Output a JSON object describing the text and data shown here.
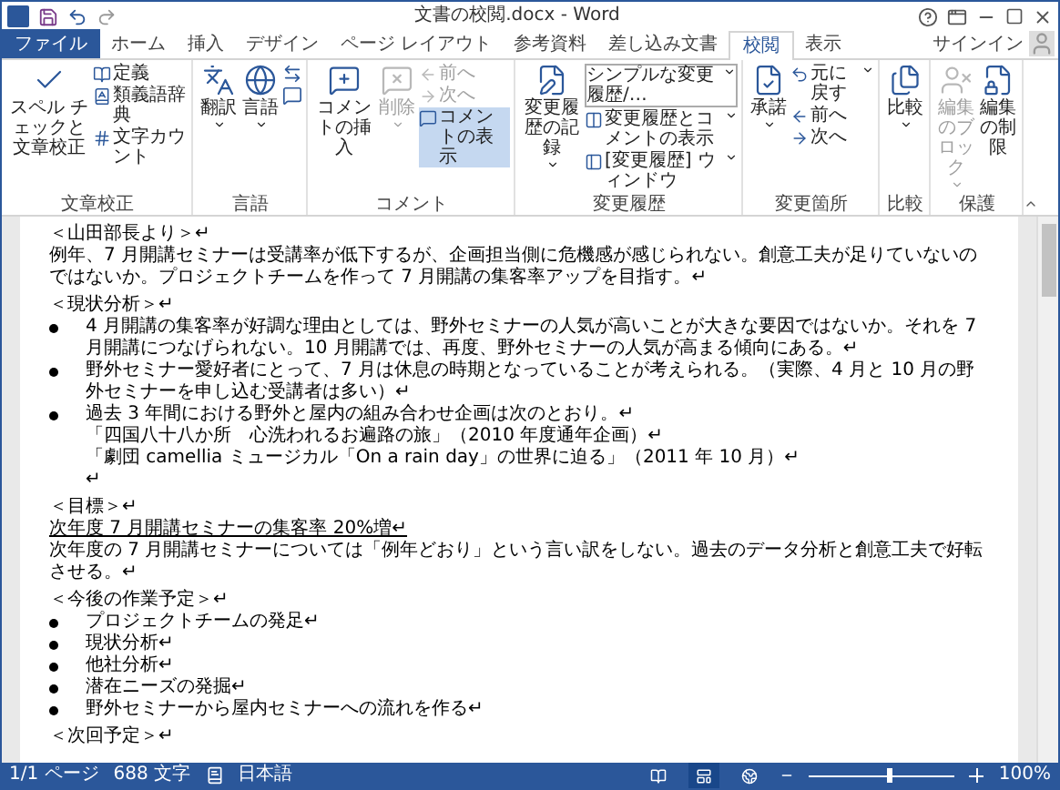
{
  "window": {
    "title": "文書の校閲.docx - Word"
  },
  "tabs": [
    {
      "label": "ファイル",
      "kind": "file",
      "selected": false
    },
    {
      "label": "ホーム",
      "kind": "tab",
      "selected": false
    },
    {
      "label": "挿入",
      "kind": "tab",
      "selected": false
    },
    {
      "label": "デザイン",
      "kind": "tab",
      "selected": false
    },
    {
      "label": "ページ レイアウト",
      "kind": "tab",
      "selected": false
    },
    {
      "label": "参考資料",
      "kind": "tab",
      "selected": false
    },
    {
      "label": "差し込み文書",
      "kind": "tab",
      "selected": false
    },
    {
      "label": "校閲",
      "kind": "tab",
      "selected": true
    },
    {
      "label": "表示",
      "kind": "tab",
      "selected": false
    }
  ],
  "account": {
    "label": "サインイン"
  },
  "ribbon": [
    {
      "label": "文章校正",
      "items": [
        {
          "kind": "large",
          "label": "スペル チェックと文章校正",
          "disabled": false,
          "on": false,
          "menu": false
        },
        {
          "kind": "small",
          "label": "定義",
          "disabled": false,
          "on": false,
          "menu": false
        },
        {
          "kind": "small",
          "label": "類義語辞典",
          "disabled": false,
          "on": false,
          "menu": false
        },
        {
          "kind": "small",
          "label": "文字カウント",
          "disabled": false,
          "on": false,
          "menu": false
        }
      ]
    },
    {
      "label": "言語",
      "items": [
        {
          "kind": "large",
          "label": "翻訳",
          "disabled": false,
          "on": false,
          "menu": true
        },
        {
          "kind": "large",
          "label": "言語",
          "disabled": false,
          "on": false,
          "menu": true
        },
        {
          "kind": "icon",
          "disabled": false,
          "on": false,
          "menu": false
        },
        {
          "kind": "icon",
          "disabled": false,
          "on": false,
          "menu": false
        }
      ]
    },
    {
      "label": "コメント",
      "items": [
        {
          "kind": "large",
          "label": "コメントの挿入",
          "disabled": false,
          "on": false,
          "menu": false
        },
        {
          "kind": "large",
          "label": "削除",
          "disabled": true,
          "on": false,
          "menu": true
        },
        {
          "kind": "small",
          "label": "前へ",
          "disabled": true,
          "on": false,
          "menu": false
        },
        {
          "kind": "small",
          "label": "次へ",
          "disabled": true,
          "on": false,
          "menu": false
        },
        {
          "kind": "small",
          "label": "コメントの表示",
          "disabled": false,
          "on": true,
          "menu": false
        }
      ]
    },
    {
      "label": "変更履歴",
      "items": [
        {
          "kind": "large",
          "label": "変更履歴の記録",
          "disabled": false,
          "on": false,
          "menu": true
        },
        {
          "kind": "dropdown",
          "label": "シンプルな変更履歴/…",
          "disabled": false,
          "on": false,
          "menu": true
        },
        {
          "kind": "small",
          "label": "変更履歴とコメントの表示",
          "disabled": false,
          "on": false,
          "menu": true
        },
        {
          "kind": "small",
          "label": "[変更履歴] ウィンドウ",
          "disabled": false,
          "on": false,
          "menu": true
        }
      ]
    },
    {
      "label": "変更箇所",
      "items": [
        {
          "kind": "large",
          "label": "承諾",
          "disabled": false,
          "on": false,
          "menu": true
        },
        {
          "kind": "small",
          "label": "元に戻す",
          "disabled": false,
          "on": false,
          "menu": true
        },
        {
          "kind": "small",
          "label": "前へ",
          "disabled": false,
          "on": false,
          "menu": false
        },
        {
          "kind": "small",
          "label": "次へ",
          "disabled": false,
          "on": false,
          "menu": false
        }
      ]
    },
    {
      "label": "比較",
      "items": [
        {
          "kind": "large",
          "label": "比較",
          "disabled": false,
          "on": false,
          "menu": true
        }
      ]
    },
    {
      "label": "保護",
      "items": [
        {
          "kind": "large",
          "label": "編集のブロック",
          "disabled": true,
          "on": false,
          "menu": true
        },
        {
          "kind": "large",
          "label": "編集の制限",
          "disabled": false,
          "on": false,
          "menu": false
        }
      ]
    }
  ],
  "document": [
    {
      "kind": "heading",
      "text": "＜山田部長より＞↵"
    },
    {
      "kind": "para",
      "text": "例年、7 月開講セミナーは受講率が低下するが、企画担当側に危機感が感じられない。創意工夫が足りていないのではないか。プロジェクトチームを作って 7 月開講の集客率アップを目指す。↵"
    },
    {
      "kind": "heading",
      "text": "＜現状分析＞↵"
    },
    {
      "kind": "bullet",
      "text": "4 月開講の集客率が好調な理由としては、野外セミナーの人気が高いことが大きな要因ではないか。それを 7 月開講につなげられない。10 月開講では、再度、野外セミナーの人気が高まる傾向にある。↵"
    },
    {
      "kind": "bullet",
      "text": "野外セミナー愛好者にとって、7 月は休息の時期となっていることが考えられる。（実際、4 月と 10 月の野外セミナーを申し込む受講者は多い）↵"
    },
    {
      "kind": "bullet",
      "text": "過去 3 年間における野外と屋内の組み合わせ企画は次のとおり。↵"
    },
    {
      "kind": "indent",
      "text": "「四国八十八か所　心洗われるお遍路の旅」（2010 年度通年企画）↵"
    },
    {
      "kind": "indent",
      "text": "「劇団 camellia ミュージカル「On a rain day」の世界に迫る」（2011 年 10 月）↵"
    },
    {
      "kind": "indent",
      "text": "↵"
    },
    {
      "kind": "heading",
      "text": "＜目標＞↵"
    },
    {
      "kind": "underline",
      "text": "次年度 7 月開講セミナーの集客率 20%増↵"
    },
    {
      "kind": "para",
      "text": "次年度の 7 月開講セミナーについては「例年どおり」という言い訳をしない。過去のデータ分析と創意工夫で好転させる。↵"
    },
    {
      "kind": "heading",
      "text": "＜今後の作業予定＞↵"
    },
    {
      "kind": "bullet",
      "text": "プロジェクトチームの発足↵"
    },
    {
      "kind": "bullet",
      "text": "現状分析↵"
    },
    {
      "kind": "bullet",
      "text": "他社分析↵"
    },
    {
      "kind": "bullet",
      "text": "潜在ニーズの発掘↵"
    },
    {
      "kind": "bullet",
      "text": "野外セミナーから屋内セミナーへの流れを作る↵"
    },
    {
      "kind": "heading",
      "text": "＜次回予定＞↵"
    }
  ],
  "status_bar": {
    "page": "1/1 ページ",
    "words": "688 文字",
    "language": "日本語",
    "views": [
      {
        "selected": false
      },
      {
        "selected": true
      },
      {
        "selected": false
      }
    ],
    "zoom": {
      "level": 0.55,
      "reading": "100%"
    }
  }
}
